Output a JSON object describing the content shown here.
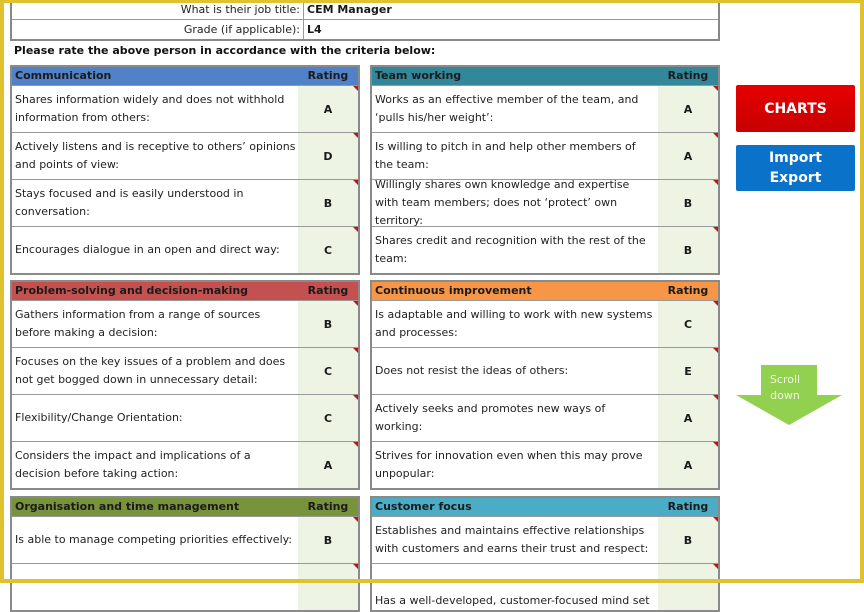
{
  "info": {
    "job_title_label": "What is their job title:",
    "job_title_value": "CEM Manager",
    "grade_label": "Grade (if applicable):",
    "grade_value": "L4"
  },
  "instruction": "Please rate the above person in accordance with the criteria below:",
  "rating_header": "Rating",
  "colors": {
    "communication": "#5181c6",
    "team_working": "#33879a",
    "problem_solving": "#c55050",
    "continuous_improvement": "#f79646",
    "organisation": "#77933c",
    "customer_focus": "#4bacc6",
    "charts_button": "#d90000",
    "import_button": "#0a72c8",
    "scroll_arrow": "#92d050"
  },
  "sections": {
    "communication": {
      "title": "Communication",
      "rows": [
        {
          "text": "Shares information widely and does not withhold information from others:",
          "rating": "A"
        },
        {
          "text": "Actively listens and is receptive to others’ opinions and points of view:",
          "rating": "D"
        },
        {
          "text": "Stays focused and is easily understood in conversation:",
          "rating": "B"
        },
        {
          "text": "Encourages dialogue in an open and direct way:",
          "rating": "C"
        }
      ]
    },
    "team_working": {
      "title": "Team working",
      "rows": [
        {
          "text": "Works as an effective member of the team, and ‘pulls his/her weight’:",
          "rating": "A"
        },
        {
          "text": "Is willing to pitch in and help other members of the team:",
          "rating": "A"
        },
        {
          "text": "Willingly shares own knowledge and expertise with team members; does not ‘protect’ own territory:",
          "rating": "B"
        },
        {
          "text": "Shares credit and recognition with the rest of the team:",
          "rating": "B"
        }
      ]
    },
    "problem_solving": {
      "title": "Problem-solving and decision-making",
      "rows": [
        {
          "text": "Gathers information from a range of sources before making a decision:",
          "rating": "B"
        },
        {
          "text": "Focuses on the key issues of a problem and does not get bogged down in unnecessary detail:",
          "rating": "C"
        },
        {
          "text": "Flexibility/Change Orientation:",
          "rating": "C"
        },
        {
          "text": "Considers the impact and implications of a decision before taking action:",
          "rating": "A"
        }
      ]
    },
    "continuous_improvement": {
      "title": "Continuous improvement",
      "rows": [
        {
          "text": "Is adaptable and willing to work with new systems and processes:",
          "rating": "C"
        },
        {
          "text": "Does not resist the ideas of others:",
          "rating": "E"
        },
        {
          "text": "Actively seeks and promotes new ways of working:",
          "rating": "A"
        },
        {
          "text": "Strives for innovation even when this may prove unpopular:",
          "rating": "A"
        }
      ]
    },
    "organisation": {
      "title": "Organisation and time management",
      "rows": [
        {
          "text": "Is able to manage competing priorities effectively:",
          "rating": "B"
        },
        {
          "text": "",
          "rating": ""
        }
      ]
    },
    "customer_focus": {
      "title": "Customer focus",
      "rows": [
        {
          "text": "Establishes and maintains effective relationships with customers and earns their trust and respect:",
          "rating": "B"
        },
        {
          "text": "Has a well-developed, customer-focused mind set",
          "rating": ""
        }
      ]
    }
  },
  "buttons": {
    "charts": "CHARTS",
    "import_line1": "Import",
    "import_line2": "Export",
    "scroll_line1": "Scroll",
    "scroll_line2": "down"
  }
}
